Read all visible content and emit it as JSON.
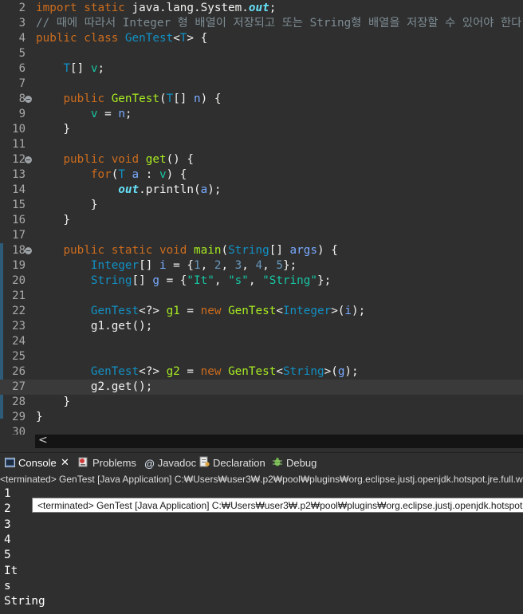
{
  "editor": {
    "lines": [
      {
        "n": "2",
        "fold": false,
        "tokens": [
          [
            "kw",
            "import "
          ],
          [
            "kw",
            "static "
          ],
          [
            "pl",
            "java.lang.System."
          ],
          [
            "fld",
            "out"
          ],
          [
            "pl",
            ";"
          ]
        ]
      },
      {
        "n": "3",
        "fold": false,
        "tokens": [
          [
            "cm",
            "// 때에 따라서 Integer 형 배열이 저장되고 또는 String형 배열을 저장할 수 있어야 한다."
          ]
        ]
      },
      {
        "n": "4",
        "fold": false,
        "tokens": [
          [
            "kw",
            "public "
          ],
          [
            "kw",
            "class "
          ],
          [
            "ty",
            "GenTest"
          ],
          [
            "pl",
            "<"
          ],
          [
            "ty",
            "T"
          ],
          [
            "pl",
            "> {"
          ]
        ]
      },
      {
        "n": "5",
        "fold": false,
        "tokens": []
      },
      {
        "n": "6",
        "fold": false,
        "tokens": [
          [
            "pl",
            "    "
          ],
          [
            "ty",
            "T"
          ],
          [
            "pl",
            "[] "
          ],
          [
            "st",
            "v"
          ],
          [
            "pl",
            ";"
          ]
        ]
      },
      {
        "n": "7",
        "fold": false,
        "tokens": []
      },
      {
        "n": "8",
        "fold": true,
        "tokens": [
          [
            "pl",
            "    "
          ],
          [
            "kw",
            "public "
          ],
          [
            "mt",
            "GenTest"
          ],
          [
            "pl",
            "("
          ],
          [
            "ty",
            "T"
          ],
          [
            "pl",
            "[] "
          ],
          [
            "var",
            "n"
          ],
          [
            "pl",
            ") {"
          ]
        ]
      },
      {
        "n": "9",
        "fold": false,
        "tokens": [
          [
            "pl",
            "        "
          ],
          [
            "st",
            "v"
          ],
          [
            "pl",
            " = "
          ],
          [
            "var",
            "n"
          ],
          [
            "pl",
            ";"
          ]
        ]
      },
      {
        "n": "10",
        "fold": false,
        "tokens": [
          [
            "pl",
            "    }"
          ]
        ]
      },
      {
        "n": "11",
        "fold": false,
        "tokens": []
      },
      {
        "n": "12",
        "fold": true,
        "tokens": [
          [
            "pl",
            "    "
          ],
          [
            "kw",
            "public "
          ],
          [
            "kw",
            "void "
          ],
          [
            "mt",
            "get"
          ],
          [
            "pl",
            "() {"
          ]
        ]
      },
      {
        "n": "13",
        "fold": false,
        "tokens": [
          [
            "pl",
            "        "
          ],
          [
            "kw",
            "for"
          ],
          [
            "pl",
            "("
          ],
          [
            "ty",
            "T"
          ],
          [
            "pl",
            " "
          ],
          [
            "var",
            "a"
          ],
          [
            "pl",
            " : "
          ],
          [
            "st",
            "v"
          ],
          [
            "pl",
            ") {"
          ]
        ]
      },
      {
        "n": "14",
        "fold": false,
        "tokens": [
          [
            "pl",
            "            "
          ],
          [
            "fld",
            "out"
          ],
          [
            "pl",
            "."
          ],
          [
            "pl",
            "println"
          ],
          [
            "pl",
            "("
          ],
          [
            "var",
            "a"
          ],
          [
            "pl",
            ");"
          ]
        ]
      },
      {
        "n": "15",
        "fold": false,
        "tokens": [
          [
            "pl",
            "        }"
          ]
        ]
      },
      {
        "n": "16",
        "fold": false,
        "tokens": [
          [
            "pl",
            "    }"
          ]
        ]
      },
      {
        "n": "17",
        "fold": false,
        "tokens": []
      },
      {
        "n": "18",
        "fold": true,
        "tokens": [
          [
            "pl",
            "    "
          ],
          [
            "kw",
            "public "
          ],
          [
            "kw",
            "static "
          ],
          [
            "kw",
            "void "
          ],
          [
            "mt",
            "main"
          ],
          [
            "pl",
            "("
          ],
          [
            "ty",
            "String"
          ],
          [
            "pl",
            "[] "
          ],
          [
            "var",
            "args"
          ],
          [
            "pl",
            ") {"
          ]
        ]
      },
      {
        "n": "19",
        "fold": false,
        "tokens": [
          [
            "pl",
            "        "
          ],
          [
            "ty",
            "Integer"
          ],
          [
            "pl",
            "[] "
          ],
          [
            "var",
            "i"
          ],
          [
            "pl",
            " = {"
          ],
          [
            "num",
            "1"
          ],
          [
            "pl",
            ", "
          ],
          [
            "num",
            "2"
          ],
          [
            "pl",
            ", "
          ],
          [
            "num",
            "3"
          ],
          [
            "pl",
            ", "
          ],
          [
            "num",
            "4"
          ],
          [
            "pl",
            ", "
          ],
          [
            "num",
            "5"
          ],
          [
            "pl",
            "};"
          ]
        ]
      },
      {
        "n": "20",
        "fold": false,
        "tokens": [
          [
            "pl",
            "        "
          ],
          [
            "ty",
            "String"
          ],
          [
            "pl",
            "[] "
          ],
          [
            "var",
            "g"
          ],
          [
            "pl",
            " = {"
          ],
          [
            "st",
            "\"It\""
          ],
          [
            "pl",
            ", "
          ],
          [
            "st",
            "\"s\""
          ],
          [
            "pl",
            ", "
          ],
          [
            "st",
            "\"String\""
          ],
          [
            "pl",
            "};"
          ]
        ]
      },
      {
        "n": "21",
        "fold": false,
        "tokens": []
      },
      {
        "n": "22",
        "fold": false,
        "tokens": [
          [
            "pl",
            "        "
          ],
          [
            "ty",
            "GenTest"
          ],
          [
            "pl",
            "<?> "
          ],
          [
            "mt",
            "g1"
          ],
          [
            "pl",
            " = "
          ],
          [
            "kw",
            "new "
          ],
          [
            "mt",
            "GenTest"
          ],
          [
            "pl",
            "<"
          ],
          [
            "ty",
            "Integer"
          ],
          [
            "pl",
            ">("
          ],
          [
            "var",
            "i"
          ],
          [
            "pl",
            ");"
          ]
        ]
      },
      {
        "n": "23",
        "fold": false,
        "tokens": [
          [
            "pl",
            "        "
          ],
          [
            "pl",
            "g1.get();"
          ]
        ]
      },
      {
        "n": "24",
        "fold": false,
        "tokens": []
      },
      {
        "n": "25",
        "fold": false,
        "tokens": []
      },
      {
        "n": "26",
        "fold": false,
        "tokens": [
          [
            "pl",
            "        "
          ],
          [
            "ty",
            "GenTest"
          ],
          [
            "pl",
            "<?> "
          ],
          [
            "mt",
            "g2"
          ],
          [
            "pl",
            " = "
          ],
          [
            "kw",
            "new "
          ],
          [
            "mt",
            "GenTest"
          ],
          [
            "pl",
            "<"
          ],
          [
            "ty",
            "String"
          ],
          [
            "pl",
            ">("
          ],
          [
            "var",
            "g"
          ],
          [
            "pl",
            ");"
          ]
        ]
      },
      {
        "n": "27",
        "fold": false,
        "current": true,
        "tokens": [
          [
            "pl",
            "        "
          ],
          [
            "pl",
            "g2.get();"
          ]
        ]
      },
      {
        "n": "28",
        "fold": false,
        "tokens": [
          [
            "pl",
            "    }"
          ]
        ]
      },
      {
        "n": "29",
        "fold": false,
        "tokens": [
          [
            "pl",
            "}"
          ]
        ]
      },
      {
        "n": "30",
        "fold": false,
        "tokens": []
      }
    ],
    "scroll_arrow": "<"
  },
  "console_tabs": [
    {
      "id": "console",
      "label": "Console",
      "active": true,
      "icon": "console-icon"
    },
    {
      "id": "problems",
      "label": "Problems",
      "active": false,
      "icon": "problems-icon"
    },
    {
      "id": "javadoc",
      "label": "Javadoc",
      "active": false,
      "icon": "javadoc-icon"
    },
    {
      "id": "declaration",
      "label": "Declaration",
      "active": false,
      "icon": "declaration-icon"
    },
    {
      "id": "debug",
      "label": "Debug",
      "active": false,
      "icon": "debug-icon"
    }
  ],
  "close_glyph": "✕",
  "terminated_path": "<terminated> GenTest [Java Application] C:₩Users₩user3₩.p2₩pool₩plugins₩org.eclipse.justj.openjdk.hotspot.jre.full.win",
  "tooltip": "<terminated> GenTest [Java Application] C:₩Users₩user3₩.p2₩pool₩plugins₩org.eclipse.justj.openjdk.hotspot.jre",
  "output": [
    "1",
    "2",
    "3",
    "4",
    "5",
    "It",
    "s",
    "String"
  ]
}
